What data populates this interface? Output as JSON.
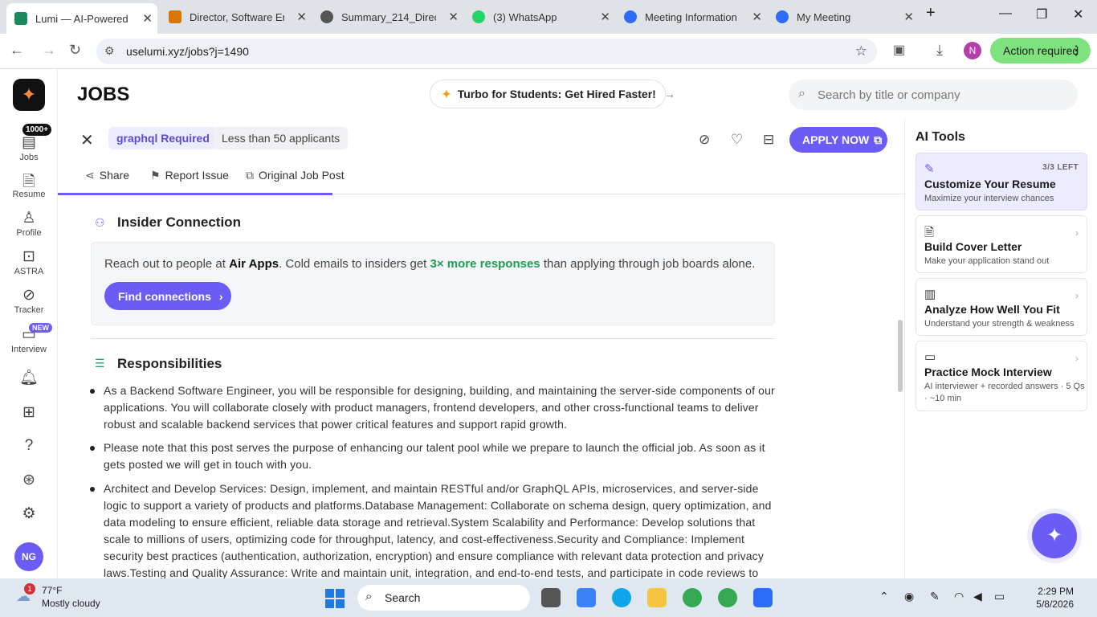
{
  "browser": {
    "tabs": [
      {
        "label": "Lumi — AI-Powered Jc",
        "active": true
      },
      {
        "label": "Director, Software Eng"
      },
      {
        "label": "Summary_214_Directo"
      },
      {
        "label": "(3) WhatsApp"
      },
      {
        "label": "Meeting Information"
      },
      {
        "label": "My Meeting"
      }
    ],
    "url": "uselumi.xyz/jobs?j=1490",
    "action_label": "Action required",
    "profile_initial": "N"
  },
  "sidebar": {
    "badge_count": "1000+",
    "badge_new": "NEW",
    "items": [
      {
        "label": "Jobs",
        "icon": "briefcase-icon"
      },
      {
        "label": "Resume",
        "icon": "document-icon"
      },
      {
        "label": "Profile",
        "icon": "person-icon"
      },
      {
        "label": "ASTRA",
        "icon": "robot-icon"
      },
      {
        "label": "Tracker",
        "icon": "check-circle-icon"
      },
      {
        "label": "Interview",
        "icon": "video-icon"
      }
    ],
    "avatar_initials": "NG"
  },
  "header": {
    "title": "JOBS",
    "promo": "Turbo for Students: Get Hired Faster!",
    "search_placeholder": "Search by title or company"
  },
  "job": {
    "tags": [
      "graphql Required",
      "Less than 50 applicants"
    ],
    "apply_label": "APPLY NOW",
    "actions": [
      "Share",
      "Report Issue",
      "Original Job Post"
    ]
  },
  "insider": {
    "heading": "Insider Connection",
    "text_pre": "Reach out to people at ",
    "company": "Air Apps",
    "text_mid": ". Cold emails to insiders get ",
    "highlight": "3× more responses",
    "text_post": " than applying through job boards alone.",
    "button": "Find connections"
  },
  "responsibilities": {
    "heading": "Responsibilities",
    "items": [
      "As a Backend Software Engineer, you will be responsible for designing, building, and maintaining the server-side components of our applications. You will collaborate closely with product managers, frontend developers, and other cross-functional teams to deliver robust and scalable backend services that power critical features and support rapid growth.",
      "Please note that this post serves the purpose of enhancing our talent pool while we prepare to launch the official job. As soon as it gets posted we will get in touch with you.",
      "Architect and Develop Services: Design, implement, and maintain RESTful and/or GraphQL APIs, microservices, and server-side logic to support a variety of products and platforms.Database Management: Collaborate on schema design, query optimization, and data modeling to ensure efficient, reliable data storage and retrieval.System Scalability and Performance: Develop solutions that scale to millions of users, optimizing code for throughput, latency, and cost-effectiveness.Security and Compliance: Implement security best practices (authentication, authorization, encryption) and ensure compliance with relevant data protection and privacy laws.Testing and Quality Assurance: Write and maintain unit, integration, and end-to-end tests, and participate in code reviews to uphold code quality"
    ]
  },
  "ai_tools": {
    "title": "AI Tools",
    "items": [
      {
        "title": "Customize Your Resume",
        "desc": "Maximize your interview chances",
        "count": "3/3 LEFT"
      },
      {
        "title": "Build Cover Letter",
        "desc": "Make your application stand out"
      },
      {
        "title": "Analyze How Well You Fit",
        "desc": "Understand your strength & weakness"
      },
      {
        "title": "Practice Mock Interview",
        "desc": "AI interviewer + recorded answers · 5 Qs · ~10 min"
      }
    ]
  },
  "taskbar": {
    "temp": "77°F",
    "weather": "Mostly cloudy",
    "weather_badge": "1",
    "search_label": "Search",
    "time": "2:29 PM",
    "date": "5/8/2026"
  }
}
